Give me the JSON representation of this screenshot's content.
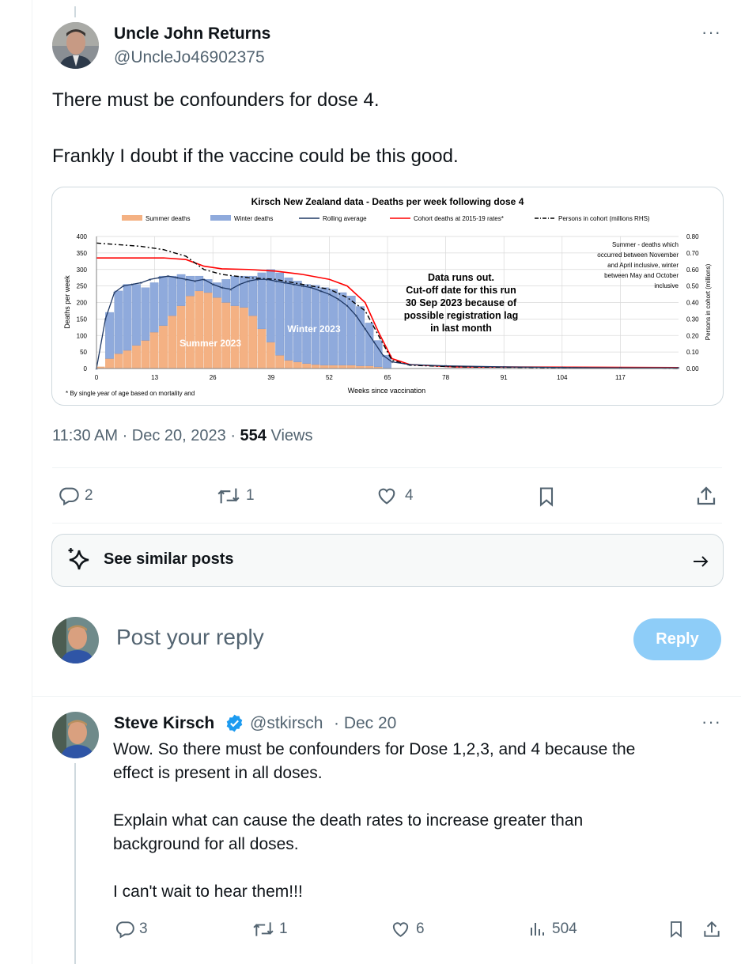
{
  "tweet": {
    "author_name": "Uncle John Returns",
    "author_handle": "@UncleJo46902375",
    "more_label": "···",
    "text_line1": "There must be confounders for dose 4.",
    "text_line2": "Frankly I doubt if the vaccine could be this good.",
    "time": "11:30 AM · Dec 20, 2023 · ",
    "views_count": "554",
    "views_label": " Views",
    "actions": {
      "replies": "2",
      "reposts": "1",
      "likes": "4"
    }
  },
  "chart_data": {
    "type": "bar",
    "title": "Kirsch New Zealand data - Deaths per week following dose 4",
    "xlabel": "Weeks since vaccination",
    "ylabel": "Deaths per week",
    "y2label": "Persons in cohort (millions)",
    "xticks": [
      "0",
      "13",
      "26",
      "39",
      "52",
      "65",
      "78",
      "91",
      "104",
      "117"
    ],
    "yticks": [
      "0",
      "50",
      "100",
      "150",
      "200",
      "250",
      "300",
      "350",
      "400"
    ],
    "y2ticks": [
      "0.00",
      "0.10",
      "0.20",
      "0.30",
      "0.40",
      "0.50",
      "0.60",
      "0.70",
      "0.80"
    ],
    "ylim": [
      0,
      400
    ],
    "xlim": [
      0,
      130
    ],
    "legend": [
      "Summer deaths",
      "Winter deaths",
      "Rolling average",
      "Cohort deaths at 2015-19 rates*",
      "Persons in cohort (millions RHS)"
    ],
    "annotations": {
      "data_runs_out": [
        "Data runs out.",
        "Cut-off date for this run",
        "30 Sep 2023 because of",
        "possible registration lag",
        "in last month"
      ],
      "summer_note": [
        "Summer - deaths which",
        "occurred between November",
        "and April inclusive, winter",
        "between May and October",
        "inclusive"
      ],
      "summer_label": "Summer 2023",
      "winter_label": "Winter 2023",
      "footnote": "* By single year of age based on mortality and"
    },
    "colors": {
      "summer": "#f4b183",
      "winter": "#8faadc",
      "rolling": "#1f3864",
      "cohort": "#ff0000",
      "persons": "#000000"
    },
    "series": [
      {
        "name": "Summer deaths",
        "x": [
          0,
          2,
          4,
          6,
          8,
          10,
          12,
          14,
          16,
          18,
          20,
          22,
          24,
          26,
          28,
          30,
          32,
          34,
          36,
          38,
          40,
          42,
          44,
          46,
          48,
          50,
          52,
          54,
          56,
          58,
          60,
          62,
          64
        ],
        "values": [
          5,
          30,
          45,
          55,
          70,
          85,
          110,
          130,
          160,
          190,
          220,
          235,
          230,
          215,
          200,
          190,
          185,
          160,
          120,
          80,
          40,
          25,
          20,
          15,
          12,
          10,
          10,
          10,
          10,
          8,
          8,
          5,
          0
        ]
      },
      {
        "name": "Winter deaths",
        "x": [
          0,
          2,
          4,
          6,
          8,
          10,
          12,
          14,
          16,
          18,
          20,
          22,
          24,
          26,
          28,
          30,
          32,
          34,
          36,
          38,
          40,
          42,
          44,
          46,
          48,
          50,
          52,
          54,
          56,
          58,
          60,
          62,
          64
        ],
        "values": [
          0,
          140,
          190,
          200,
          185,
          160,
          150,
          150,
          120,
          95,
          60,
          45,
          40,
          45,
          70,
          90,
          95,
          120,
          170,
          220,
          250,
          250,
          245,
          240,
          240,
          235,
          230,
          220,
          210,
          180,
          130,
          80,
          40
        ]
      },
      {
        "name": "Rolling average",
        "x": [
          0,
          2,
          4,
          6,
          8,
          10,
          12,
          14,
          16,
          18,
          20,
          22,
          24,
          26,
          28,
          30,
          32,
          34,
          36,
          38,
          40,
          42,
          44,
          46,
          48,
          50,
          52,
          54,
          56,
          58,
          60,
          62,
          64,
          66,
          70,
          78,
          91,
          104,
          117,
          130
        ],
        "values": [
          0,
          150,
          230,
          250,
          255,
          260,
          270,
          275,
          280,
          275,
          270,
          265,
          270,
          255,
          245,
          240,
          255,
          265,
          270,
          270,
          265,
          260,
          255,
          250,
          245,
          235,
          225,
          210,
          190,
          160,
          120,
          80,
          40,
          20,
          12,
          8,
          5,
          3,
          2,
          2
        ]
      },
      {
        "name": "Cohort deaths at 2015-19 rates*",
        "x": [
          0,
          5,
          10,
          15,
          20,
          24,
          28,
          34,
          40,
          46,
          52,
          56,
          60,
          63,
          66,
          70,
          80,
          130
        ],
        "values": [
          335,
          335,
          335,
          335,
          330,
          310,
          302,
          300,
          295,
          285,
          270,
          250,
          200,
          110,
          30,
          12,
          5,
          3
        ]
      },
      {
        "name": "Persons in cohort (millions RHS)",
        "x": [
          0,
          5,
          10,
          15,
          20,
          24,
          28,
          34,
          40,
          46,
          52,
          56,
          60,
          63,
          66,
          70,
          80,
          130
        ],
        "values": [
          0.76,
          0.75,
          0.74,
          0.72,
          0.68,
          0.6,
          0.57,
          0.55,
          0.54,
          0.51,
          0.48,
          0.43,
          0.35,
          0.2,
          0.05,
          0.02,
          0.01,
          0
        ]
      }
    ]
  },
  "similar": {
    "label": "See similar posts"
  },
  "compose": {
    "placeholder": "Post your reply",
    "button": "Reply"
  },
  "reply": {
    "author_name": "Steve Kirsch",
    "author_handle": "@stkirsch",
    "date": "· Dec 20",
    "more_label": "···",
    "p1_line1": "Wow. So there must be confounders for Dose 1,2,3, and 4 because the",
    "p1_line2": "effect is present in all doses.",
    "p2_line1": "Explain what can cause the death rates to increase greater than",
    "p2_line2": "background for all doses.",
    "p3": "I can't wait to hear them!!!",
    "actions": {
      "replies": "3",
      "reposts": "1",
      "likes": "6",
      "views": "504"
    }
  }
}
